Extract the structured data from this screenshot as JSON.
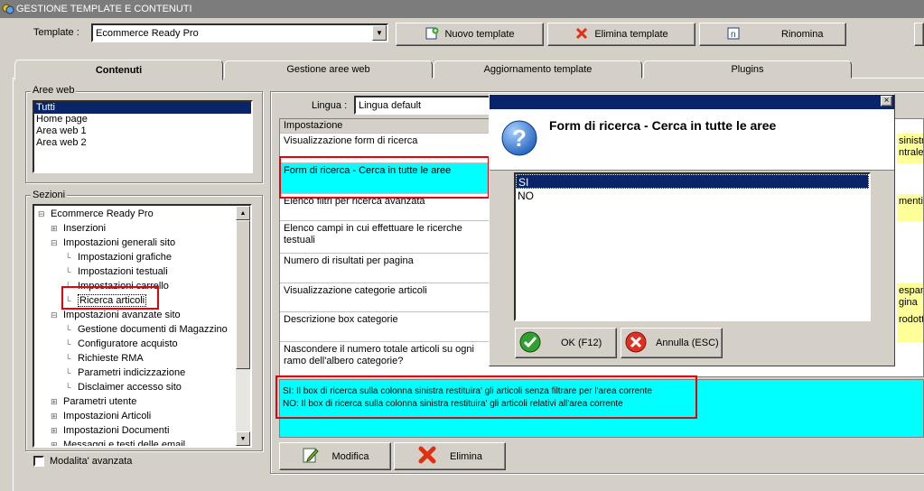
{
  "window": {
    "title": "GESTIONE TEMPLATE E CONTENUTI"
  },
  "template_bar": {
    "label": "Template :",
    "selected": "Ecommerce Ready Pro",
    "new_label": "Nuovo template",
    "delete_label": "Elimina template",
    "rename_label": "Rinomina"
  },
  "tabs": [
    {
      "label": "Contenuti"
    },
    {
      "label": "Gestione aree web"
    },
    {
      "label": "Aggiornamento template"
    },
    {
      "label": "Plugins"
    }
  ],
  "aree_web": {
    "title": "Aree web",
    "items": [
      "Tutti",
      "Home page",
      "Area web 1",
      "Area web 2"
    ]
  },
  "sezioni": {
    "title": "Sezioni",
    "tree": [
      {
        "label": "Ecommerce Ready Pro",
        "prefix": "⊟"
      },
      {
        "label": "Inserzioni",
        "prefix": "⊞"
      },
      {
        "label": "Impostazioni generali sito",
        "prefix": "⊟"
      },
      {
        "label": "Impostazioni grafiche",
        "prefix": ""
      },
      {
        "label": "Impostazioni testuali",
        "prefix": ""
      },
      {
        "label": "Impostazioni carrello",
        "prefix": ""
      },
      {
        "label": "Ricerca articoli",
        "prefix": ""
      },
      {
        "label": "Impostazioni avanzate sito",
        "prefix": "⊟"
      },
      {
        "label": "Gestione documenti di Magazzino",
        "prefix": ""
      },
      {
        "label": "Configuratore acquisto",
        "prefix": ""
      },
      {
        "label": "Richieste RMA",
        "prefix": ""
      },
      {
        "label": "Parametri indicizzazione",
        "prefix": ""
      },
      {
        "label": "Disclaimer accesso sito",
        "prefix": ""
      },
      {
        "label": "Parametri utente",
        "prefix": "⊞"
      },
      {
        "label": "Impostazioni Articoli",
        "prefix": "⊞"
      },
      {
        "label": "Impostazioni Documenti",
        "prefix": "⊞"
      },
      {
        "label": "Messaggi e testi delle email",
        "prefix": "⊞"
      }
    ],
    "advanced_label": "Modalita' avanzata"
  },
  "lingua": {
    "label": "Lingua :",
    "selected": "Lingua default"
  },
  "grid": {
    "header": "Impostazione",
    "rows": [
      "Visualizzazione form di ricerca",
      "Form di ricerca - Cerca in tutte le aree",
      "Elenco filtri per ricerca avanzata",
      "Elenco campi in cui effettuare le ricerche testuali",
      "Numero di risultati per pagina",
      "Visualizzazione categorie articoli",
      "Descrizione box categorie",
      "Nascondere il numero totale articoli su ogni ramo dell'albero categorie?"
    ],
    "right_fragments": [
      "sinistra",
      "ntrale",
      "menti",
      "espand",
      "gina",
      "rodotto"
    ]
  },
  "description": {
    "line1": "SI: Il box di ricerca sulla colonna sinistra restituira' gli articoli senza filtrare per l'area corrente",
    "line2": "NO: Il box di ricerca sulla colonna sinistra restituira' gli articoli relativi all'area corrente"
  },
  "bottom_buttons": {
    "edit_label": "Modifica",
    "delete_label": "Elimina"
  },
  "dialog": {
    "title": "Form di ricerca - Cerca in tutte le aree",
    "close": "×",
    "options": [
      "SI",
      "NO"
    ],
    "selected": "SI",
    "ok_label": "OK (F12)",
    "cancel_label": "Annulla (ESC)"
  },
  "colors": {
    "highlight": "#00ffff",
    "selection": "#0a246a",
    "annotation": "#e8000b",
    "yellow": "#ffff99"
  }
}
